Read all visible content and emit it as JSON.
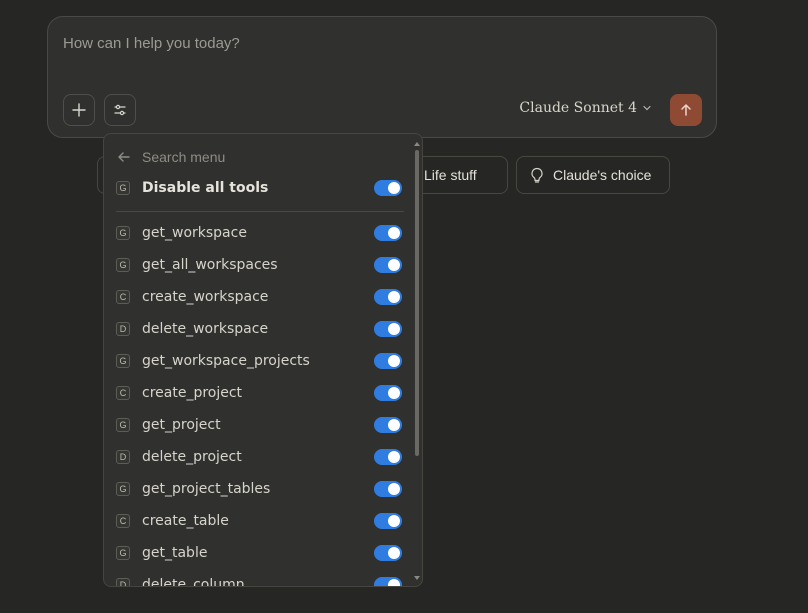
{
  "composer": {
    "placeholder": "How can I help you today?",
    "model_label": "Claude Sonnet 4"
  },
  "chips": [
    {
      "label": "Life stuff",
      "icon": "coffee-icon"
    },
    {
      "label": "Claude's choice",
      "icon": "lightbulb-icon"
    }
  ],
  "menu": {
    "search_placeholder": "Search menu",
    "disable_all": {
      "badge": "G",
      "label": "Disable all tools",
      "enabled": true
    },
    "items": [
      {
        "badge": "G",
        "label": "get_workspace",
        "enabled": true
      },
      {
        "badge": "G",
        "label": "get_all_workspaces",
        "enabled": true
      },
      {
        "badge": "C",
        "label": "create_workspace",
        "enabled": true
      },
      {
        "badge": "D",
        "label": "delete_workspace",
        "enabled": true
      },
      {
        "badge": "G",
        "label": "get_workspace_projects",
        "enabled": true
      },
      {
        "badge": "C",
        "label": "create_project",
        "enabled": true
      },
      {
        "badge": "G",
        "label": "get_project",
        "enabled": true
      },
      {
        "badge": "D",
        "label": "delete_project",
        "enabled": true
      },
      {
        "badge": "G",
        "label": "get_project_tables",
        "enabled": true
      },
      {
        "badge": "C",
        "label": "create_table",
        "enabled": true
      },
      {
        "badge": "G",
        "label": "get_table",
        "enabled": true
      },
      {
        "badge": "D",
        "label": "delete_column",
        "enabled": true
      }
    ]
  },
  "colors": {
    "background": "#262624",
    "panel": "#30302e",
    "accent": "#2f7de1",
    "send_button": "#8f4a33"
  }
}
